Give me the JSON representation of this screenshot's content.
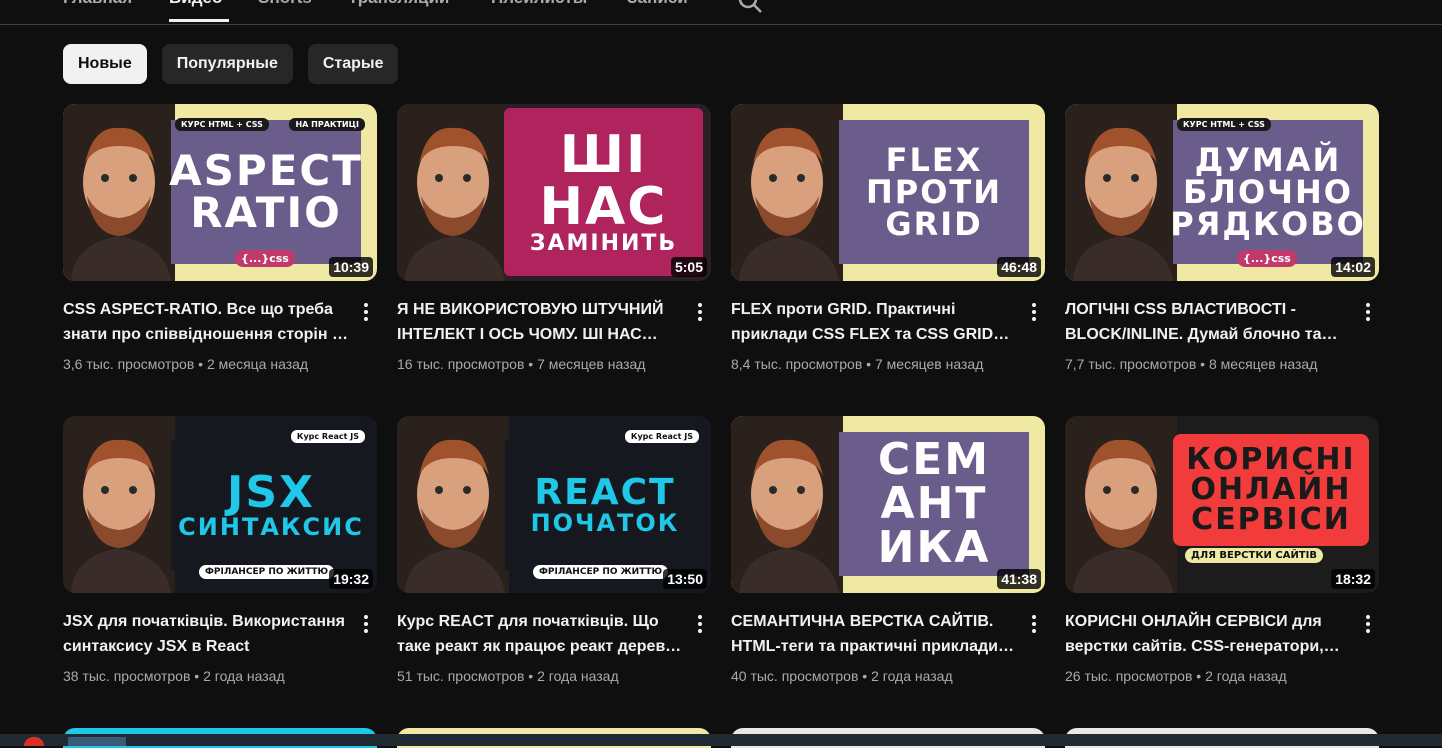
{
  "tabs": [
    {
      "label": "Главная"
    },
    {
      "label": "Видео"
    },
    {
      "label": "Shorts"
    },
    {
      "label": "Трансляции"
    },
    {
      "label": "Плейлисты"
    },
    {
      "label": "Записи"
    }
  ],
  "chips": [
    {
      "label": "Новые"
    },
    {
      "label": "Популярные"
    },
    {
      "label": "Старые"
    }
  ],
  "videos": [
    {
      "title": "CSS ASPECT-RATIO. Все що треба знати про співвідношення сторін в CSS",
      "views": "3,6 тыс. просмотров",
      "age": "2 месяца назад",
      "duration": "10:39",
      "thumb_text": [
        "ASPECT",
        "RATIO"
      ],
      "tag_left": "КУРС HTML + CSS",
      "tag_right": "НА ПРАКТИЦІ",
      "badge": "{...}css",
      "colors": {
        "bg": "#efe9a4",
        "panel": "#6a5d8c",
        "text": "#ffffff"
      }
    },
    {
      "title": "Я НЕ ВИКОРИСТОВУЮ ШТУЧНИЙ ІНТЕЛЕКТ І ОСЬ ЧОМУ. ШІ НАС ЗАМІНИТЬ?",
      "views": "16 тыс. просмотров",
      "age": "7 месяцев назад",
      "duration": "5:05",
      "thumb_text": [
        "ШІ",
        "НАС",
        "ЗАМІНИТЬ"
      ],
      "colors": {
        "bg": "#2a1f24",
        "panel": "#b0245e",
        "text": "#ffffff"
      }
    },
    {
      "title": "FLEX проти GRID. Практичні приклади CSS FLEX та CSS GRID layout",
      "views": "8,4 тыс. просмотров",
      "age": "7 месяцев назад",
      "duration": "46:48",
      "thumb_text": [
        "FLEX",
        "ПРОТИ",
        "GRID"
      ],
      "colors": {
        "bg": "#efe9a4",
        "panel": "#6a5d8c",
        "text": "#ffffff"
      }
    },
    {
      "title": "ЛОГІЧНІ CSS ВЛАСТИВОСТІ - BLOCK/INLINE. Думай блочно та рядково",
      "views": "7,7 тыс. просмотров",
      "age": "8 месяцев назад",
      "duration": "14:02",
      "thumb_text": [
        "ДУМАЙ",
        "БЛОЧНО",
        "РЯДКОВО"
      ],
      "tag_left": "КУРС HTML + CSS",
      "badge": "{...}css",
      "colors": {
        "bg": "#efe9a4",
        "panel": "#6a5d8c",
        "text": "#ffffff"
      }
    },
    {
      "title": "JSX для початківців. Використання синтаксису JSX в React",
      "views": "38 тыс. просмотров",
      "age": "2 года назад",
      "duration": "19:32",
      "thumb_text": [
        "JSX",
        "СИНТАКСИС"
      ],
      "tag_right": "Курс React JS",
      "badge": "ФРІЛАНСЕР ПО ЖИТТЮ",
      "colors": {
        "bg": "#15191f",
        "panel": "#15191f",
        "text": "#1fc8e8"
      }
    },
    {
      "title": "Курс REACT для початківців. Що таке реакт як працює реакт дерево компонентів",
      "views": "51 тыс. просмотров",
      "age": "2 года назад",
      "duration": "13:50",
      "thumb_text": [
        "REACT",
        "ПОЧАТОК"
      ],
      "tag_right": "Курс React JS",
      "badge": "ФРІЛАНСЕР ПО ЖИТТЮ",
      "colors": {
        "bg": "#15191f",
        "panel": "#15191f",
        "text": "#1fc8e8"
      }
    },
    {
      "title": "СЕМАНТИЧНА ВЕРСТКА САЙТІВ. HTML-теги та практичні приклади семантики",
      "views": "40 тыс. просмотров",
      "age": "2 года назад",
      "duration": "41:38",
      "thumb_text": [
        "СЕМ",
        "АНТ",
        "ИКА"
      ],
      "colors": {
        "bg": "#efe9a4",
        "panel": "#6a5d8c",
        "text": "#ffffff"
      }
    },
    {
      "title": "КОРИСНІ ОНЛАЙН СЕРВІСИ для верстки сайтів. CSS-генератори, шрифти",
      "views": "26 тыс. просмотров",
      "age": "2 года назад",
      "duration": "18:32",
      "thumb_text": [
        "КОРИСНІ",
        "ОНЛАЙН",
        "СЕРВІСИ"
      ],
      "badge": "ДЛЯ ВЕРСТКИ САЙТІВ",
      "colors": {
        "bg": "#1c1c1c",
        "panel": "#f23c3c",
        "text": "#1a1a1a"
      }
    }
  ],
  "colors": {
    "background": "#0f0f0f",
    "chip": "#272727",
    "chip_active": "#f1f1f1",
    "meta": "#aaaaaa"
  }
}
